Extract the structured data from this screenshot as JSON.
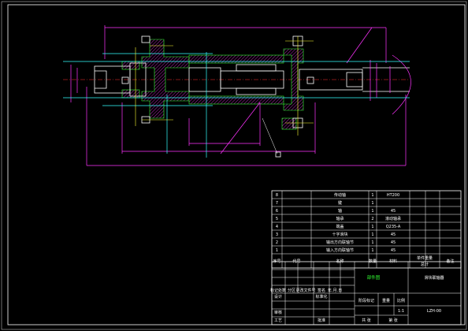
{
  "parts": [
    {
      "no": "8",
      "name": "传动轴",
      "qty": "1",
      "material": "HT200"
    },
    {
      "no": "7",
      "name": "键",
      "qty": "1",
      "material": ""
    },
    {
      "no": "6",
      "name": "轴",
      "qty": "1",
      "material": "45"
    },
    {
      "no": "5",
      "name": "轴承",
      "qty": "2",
      "material": "滚动轴承"
    },
    {
      "no": "4",
      "name": "端盖",
      "qty": "1",
      "material": "Q235-A"
    },
    {
      "no": "3",
      "name": "十字滑块",
      "qty": "1",
      "material": "45"
    },
    {
      "no": "2",
      "name": "输出方向联轴节",
      "qty": "1",
      "material": "45"
    },
    {
      "no": "1",
      "name": "输入方向联轴节",
      "qty": "1",
      "material": "45"
    }
  ],
  "header": {
    "no": "序号",
    "code": "代号",
    "name": "名称",
    "qty": "数量",
    "material": "材料",
    "unit_weight": "单件重量",
    "total_weight": "总计",
    "remark": "备注"
  },
  "title_block": {
    "drawing_name": "部件图",
    "company": "滑块联轴器",
    "drawing_no": "LZH-00",
    "scale": "1:1",
    "stage_label": "阶段标记",
    "weight_label": "重量",
    "scale_label": "比例",
    "revision_cells": [
      "标记处数",
      "分区",
      "更改文件号",
      "签名",
      "年.月.日"
    ],
    "design": "设计",
    "standard": "标准化",
    "review": "审核",
    "process": "工艺",
    "approve": "批准",
    "sheets": "共 张",
    "sheet": "第 张"
  }
}
